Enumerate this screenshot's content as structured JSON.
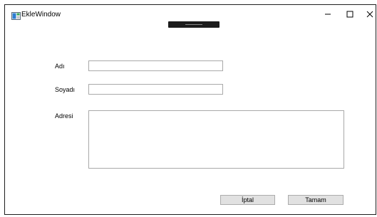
{
  "window": {
    "title": "EkleWindow",
    "controls": {
      "minimize": "–",
      "maximize": "☐",
      "close": "✕"
    }
  },
  "form": {
    "name_label": "Adı",
    "name_value": "",
    "surname_label": "Soyadı",
    "surname_value": "",
    "address_label": "Adresi",
    "address_value": ""
  },
  "buttons": {
    "cancel_label": "İptal",
    "ok_label": "Tamam"
  }
}
